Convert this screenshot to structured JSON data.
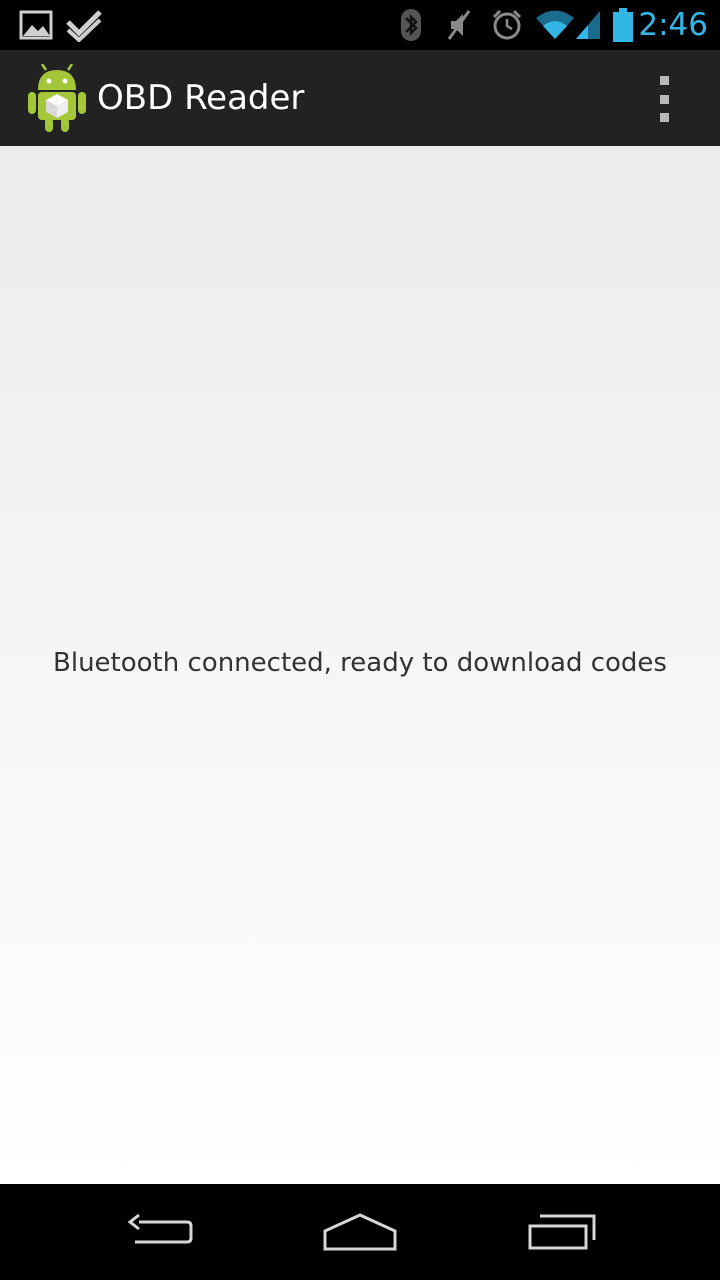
{
  "status_bar": {
    "time": "2:46",
    "icons": [
      "gallery-icon",
      "foursquare-icon",
      "bluetooth-icon",
      "mute-icon",
      "alarm-icon",
      "wifi-icon",
      "signal-icon",
      "battery-icon"
    ]
  },
  "action_bar": {
    "title": "OBD Reader",
    "overflow_icon": "more-vert-icon"
  },
  "main": {
    "status_message": "Bluetooth connected, ready to download codes"
  },
  "nav_bar": {
    "buttons": [
      "back-icon",
      "home-icon",
      "recent-apps-icon"
    ]
  },
  "colors": {
    "accent": "#33b5e5",
    "action_bar_bg": "#222222",
    "android_green": "#a4c639"
  }
}
